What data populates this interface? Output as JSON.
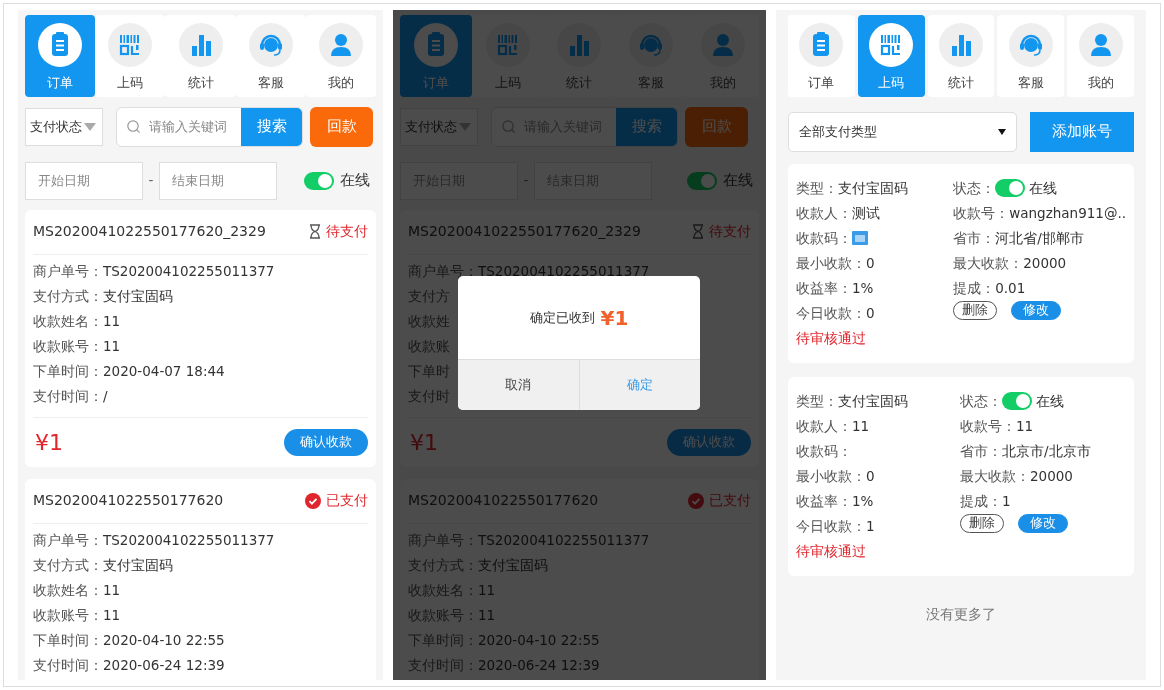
{
  "screens": [
    {
      "kind": "orders",
      "tabs": [
        {
          "label": "订单",
          "selected": true
        },
        {
          "label": "上码",
          "selected": false
        },
        {
          "label": "统计",
          "selected": false
        },
        {
          "label": "客服",
          "selected": false
        },
        {
          "label": "我的",
          "selected": false
        }
      ],
      "filter": {
        "status_select": "支付状态",
        "search": {
          "placeholder": "请输入关键词",
          "button": "搜索"
        },
        "refund_button": "回款"
      },
      "dates": {
        "start": {
          "placeholder": "开始日期"
        },
        "separator": "-",
        "end": {
          "placeholder": "结束日期"
        },
        "online": {
          "on": true,
          "label": "在线"
        }
      },
      "orders": [
        {
          "order_no": "MS2020041022550177620_2329",
          "status": "待支付",
          "kind": "pending",
          "fields": [
            {
              "label": "商户单号：",
              "value": "TS202004102255011377"
            },
            {
              "label": "支付方式：",
              "value": "支付宝固码"
            },
            {
              "label": "收款姓名：",
              "value": "11"
            },
            {
              "label": "收款账号：",
              "value": "11"
            },
            {
              "label": "下单时间：",
              "value": "2020-04-07 18:44"
            },
            {
              "label": "支付时间：",
              "value": "/"
            }
          ],
          "amount": "¥1",
          "confirm_button": "确认收款"
        },
        {
          "order_no": "MS2020041022550177620",
          "status": "已支付",
          "kind": "paid",
          "fields": [
            {
              "label": "商户单号：",
              "value": "TS202004102255011377"
            },
            {
              "label": "支付方式：",
              "value": "支付宝固码"
            },
            {
              "label": "收款姓名：",
              "value": "11"
            },
            {
              "label": "收款账号：",
              "value": "11"
            },
            {
              "label": "下单时间：",
              "value": "2020-04-10 22:55"
            },
            {
              "label": "支付时间：",
              "value": "2020-06-24 12:39"
            }
          ]
        }
      ]
    },
    {
      "kind": "orders",
      "tabs": [
        {
          "label": "订单",
          "selected": true
        },
        {
          "label": "上码",
          "selected": false
        },
        {
          "label": "统计",
          "selected": false
        },
        {
          "label": "客服",
          "selected": false
        },
        {
          "label": "我的",
          "selected": false
        }
      ],
      "filter": {
        "status_select": "支付状态",
        "search": {
          "placeholder": "请输入关键词",
          "button": "搜索"
        },
        "refund_button": "回款"
      },
      "dates": {
        "start": {
          "placeholder": "开始日期"
        },
        "separator": "-",
        "end": {
          "placeholder": "结束日期"
        },
        "online": {
          "on": true,
          "label": "在线"
        }
      },
      "orders": [
        {
          "order_no": "MS2020041022550177620_2329",
          "status": "待支付",
          "kind": "pending",
          "fields": [
            {
              "label": "商户单号：",
              "value": "TS202004102255011377"
            },
            {
              "label": "支付方"
            },
            {
              "label": "收款姓"
            },
            {
              "label": "收款账"
            },
            {
              "label": "下单时"
            },
            {
              "label": "支付时"
            }
          ],
          "amount": "¥1",
          "confirm_button": "确认收款"
        },
        {
          "order_no": "MS2020041022550177620",
          "status": "已支付",
          "kind": "paid",
          "fields": [
            {
              "label": "商户单号：",
              "value": "TS202004102255011377"
            },
            {
              "label": "支付方式：",
              "value": "支付宝固码"
            },
            {
              "label": "收款姓名：",
              "value": "11"
            },
            {
              "label": "收款账号：",
              "value": "11"
            },
            {
              "label": "下单时间：",
              "value": "2020-04-10 22:55"
            },
            {
              "label": "支付时间：",
              "value": "2020-06-24 12:39"
            }
          ]
        }
      ],
      "dialog": {
        "message": "确定已收到",
        "amount": "¥1",
        "buttons": [
          {
            "label": "取消",
            "kind": "cancel"
          },
          {
            "label": "确定",
            "kind": "confirm"
          }
        ]
      }
    },
    {
      "kind": "accounts",
      "tabs": [
        {
          "label": "订单",
          "selected": false
        },
        {
          "label": "上码",
          "selected": true
        },
        {
          "label": "统计",
          "selected": false
        },
        {
          "label": "客服",
          "selected": false
        },
        {
          "label": "我的",
          "selected": false
        }
      ],
      "type_select": "全部支付类型",
      "add_button": "添加账号",
      "accounts": [
        {
          "left": [
            {
              "kind": "text",
              "label": "类型：",
              "value": "支付宝固码"
            },
            {
              "kind": "text",
              "label": "收款人：",
              "value": "测试"
            },
            {
              "kind": "code_image",
              "label": "收款码："
            },
            {
              "kind": "text",
              "label": "最小收款：",
              "value": "0"
            },
            {
              "kind": "text",
              "label": "收益率：",
              "value": "1%"
            },
            {
              "kind": "text",
              "label": "今日收款：",
              "value": "0"
            }
          ],
          "right": [
            {
              "kind": "toggle",
              "label": "状态：",
              "on": true,
              "value": "在线"
            },
            {
              "kind": "text",
              "label": "收款号：",
              "value": "wangzhan911@.."
            },
            {
              "kind": "text",
              "label": "省市：",
              "value": "河北省/邯郸市"
            },
            {
              "kind": "text",
              "label": "最大收款：",
              "value": "20000"
            },
            {
              "kind": "text",
              "label": "提成：",
              "value": "0.01"
            },
            {
              "kind": "actions",
              "buttons": [
                {
                  "label": "删除",
                  "kind": "outline"
                },
                {
                  "label": "修改",
                  "kind": "primary"
                }
              ]
            }
          ],
          "review_status": "待审核通过"
        },
        {
          "left": [
            {
              "kind": "text",
              "label": "类型：",
              "value": "支付宝固码"
            },
            {
              "kind": "text",
              "label": "收款人：",
              "value": "11"
            },
            {
              "kind": "text",
              "label": "收款码："
            },
            {
              "kind": "text",
              "label": "最小收款：",
              "value": "0"
            },
            {
              "kind": "text",
              "label": "收益率：",
              "value": "1%"
            },
            {
              "kind": "text",
              "label": "今日收款：",
              "value": "1"
            }
          ],
          "right": [
            {
              "kind": "toggle",
              "label": "状态：",
              "on": true,
              "value": "在线"
            },
            {
              "kind": "text",
              "label": "收款号：",
              "value": "11"
            },
            {
              "kind": "text",
              "label": "省市：",
              "value": "北京市/北京市"
            },
            {
              "kind": "text",
              "label": "最大收款：",
              "value": "20000"
            },
            {
              "kind": "text",
              "label": "提成：",
              "value": "1"
            },
            {
              "kind": "actions",
              "buttons": [
                {
                  "label": "删除",
                  "kind": "outline"
                },
                {
                  "label": "修改",
                  "kind": "primary"
                }
              ]
            }
          ],
          "review_status": "待审核通过"
        }
      ],
      "end_note": "没有更多了"
    }
  ]
}
